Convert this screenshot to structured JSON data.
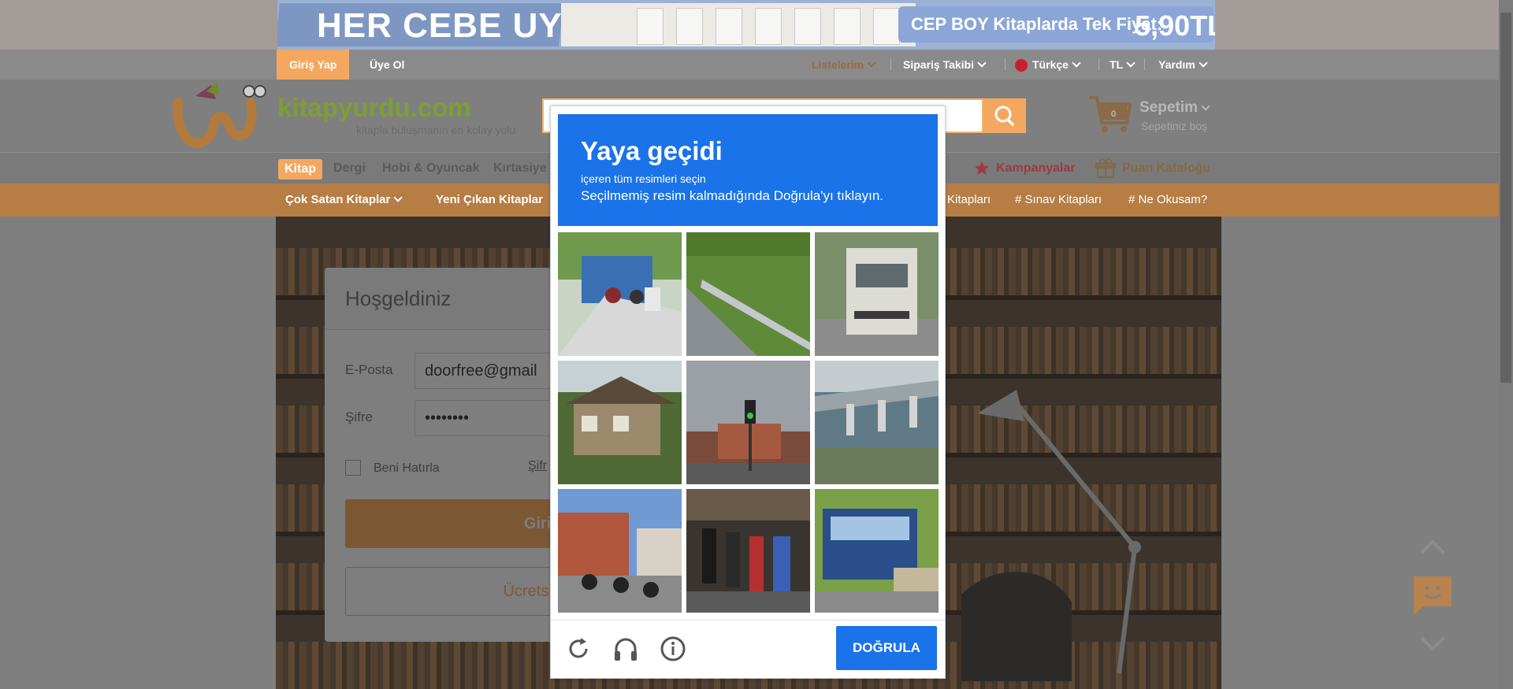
{
  "banner": {
    "headline": "HER CEBE UYGUN!",
    "promo_label": "CEP BOY Kitaplarda Tek Fiyat:",
    "promo_price": "5,90TL"
  },
  "topbar": {
    "login": "Giriş Yap",
    "register": "Üye Ol",
    "lists": "Listelerim",
    "order_tracking": "Sipariş Takibi",
    "language": "Türkçe",
    "currency": "TL",
    "help": "Yardım"
  },
  "header": {
    "logo_text": "kitapyurdu.com",
    "logo_tagline": "kitapla buluşmanın en kolay yolu",
    "cart_title": "Sepetim",
    "cart_status": "Sepetiniz boş",
    "cart_count": "0"
  },
  "categories": {
    "items": [
      "Kitap",
      "Dergi",
      "Hobi & Oyuncak",
      "Kırtasiye"
    ],
    "campaigns": "Kampanyalar",
    "points_catalog": "Puan Kataloğu"
  },
  "nav": {
    "best_sellers": "Çok Satan Kitaplar",
    "new_releases": "Yeni Çıkan Kitaplar",
    "tag_partial": "Kitapları",
    "tag_exam": "Sınav Kitapları",
    "tag_what_to_read": "Ne Okusam?"
  },
  "login": {
    "title": "Hoşgeldiniz",
    "email_label": "E-Posta",
    "email_value": "doorfree@gmail",
    "password_label": "Şifre",
    "password_value": "••••••••",
    "remember_me": "Beni Hatırla",
    "forgot_partial": "Şifr",
    "submit": "Giriş Yap",
    "free_register": "Ücretsiz Üye Ol"
  },
  "captcha": {
    "title": "Yaya geçidi",
    "instruction": "içeren tüm resimleri seçin",
    "hint": "Seçilmemiş resim kalmadığında Doğrula'yı tıklayın.",
    "verify": "DOĞRULA",
    "icons": [
      "reload-icon",
      "audio-icon",
      "info-icon"
    ],
    "tiles": [
      {
        "scene": "street-with-motorbikes"
      },
      {
        "scene": "road-guardrail"
      },
      {
        "scene": "truck"
      },
      {
        "scene": "house-with-trees"
      },
      {
        "scene": "traffic-light"
      },
      {
        "scene": "highway-bridge"
      },
      {
        "scene": "parked-motorbikes-buildings"
      },
      {
        "scene": "row-of-scooters"
      },
      {
        "scene": "bus"
      }
    ]
  },
  "colors": {
    "accent_orange": "#f4a85f",
    "captcha_blue": "#1a73e8",
    "logo_green": "#8bbe3c"
  }
}
